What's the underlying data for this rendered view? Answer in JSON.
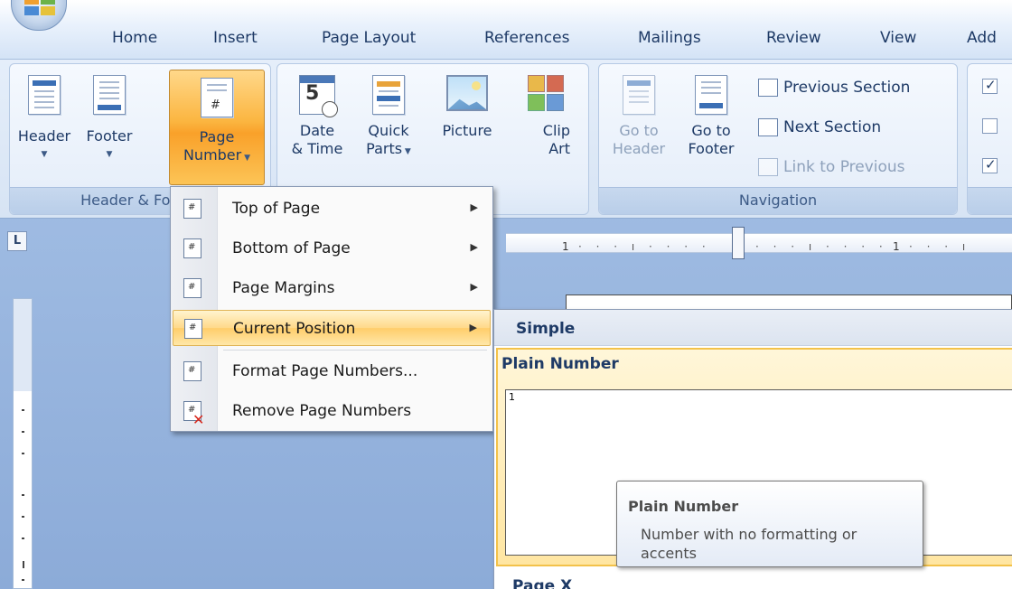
{
  "tabs": [
    "Home",
    "Insert",
    "Page Layout",
    "References",
    "Mailings",
    "Review",
    "View",
    "Add"
  ],
  "ribbon": {
    "header_footer_group": {
      "label": "Header & Footer",
      "header_label": "Header",
      "footer_label": "Footer",
      "page_number_label_1": "Page",
      "page_number_label_2": "Number"
    },
    "insert_group": {
      "date_time_1": "Date",
      "date_time_2": "& Time",
      "quick_parts_1": "Quick",
      "quick_parts_2": "Parts",
      "picture": "Picture",
      "clip_art_1": "Clip",
      "clip_art_2": "Art"
    },
    "navigation_group": {
      "label": "Navigation",
      "goto_header_1": "Go to",
      "goto_header_2": "Header",
      "goto_footer_1": "Go to",
      "goto_footer_2": "Footer",
      "previous_section": "Previous Section",
      "next_section": "Next Section",
      "link_to_previous": "Link to Previous"
    },
    "options_group": {
      "checkboxes": [
        true,
        false,
        true
      ]
    }
  },
  "ruler": {
    "corner_glyph": "L",
    "ticks": [
      "1",
      "1"
    ]
  },
  "page_number_menu": {
    "items": [
      {
        "label": "Top of Page",
        "submenu": true
      },
      {
        "label": "Bottom of Page",
        "submenu": true
      },
      {
        "label": "Page Margins",
        "submenu": true
      },
      {
        "label": "Current Position",
        "submenu": true,
        "highlighted": true
      },
      {
        "label": "Format Page Numbers...",
        "submenu": false
      },
      {
        "label": "Remove Page Numbers",
        "submenu": false
      }
    ]
  },
  "gallery": {
    "category": "Simple",
    "selected_item_title": "Plain Number",
    "preview_number": "1",
    "next_item_title": "Page X"
  },
  "tooltip": {
    "title": "Plain Number",
    "body": "Number with no formatting or accents"
  },
  "colors": {
    "accent_orange": "#f9a12a",
    "hover_yellow": "#ffd98a",
    "ribbon_text": "#1e3a66"
  }
}
